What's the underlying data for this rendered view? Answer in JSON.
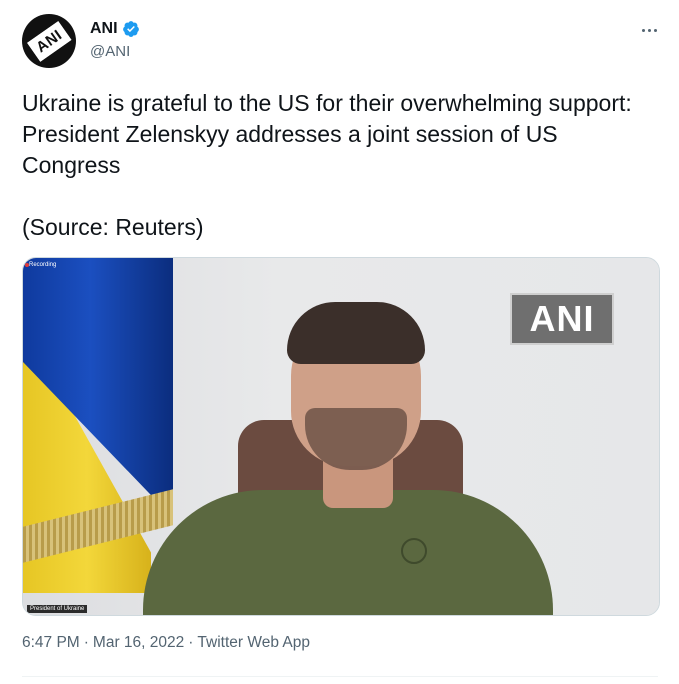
{
  "author": {
    "display_name": "ANI",
    "handle": "@ANI",
    "verified": true,
    "avatar_text": "ANI"
  },
  "tweet": {
    "text": "Ukraine is grateful to the US for their overwhelming support: President Zelenskyy addresses a joint session of US Congress\n\n(Source: Reuters)"
  },
  "media": {
    "watermark": "ANI",
    "recording_label": "Recording",
    "name_tag": "President of Ukraine"
  },
  "meta": {
    "time": "6:47 PM",
    "separator": "·",
    "date": "Mar 16, 2022",
    "source": "Twitter Web App"
  },
  "icons": {
    "verified": "verified-badge-icon",
    "more": "more-options-icon"
  },
  "colors": {
    "verified_blue": "#1d9bf0",
    "secondary_text": "#536471",
    "primary_text": "#0f1419"
  }
}
